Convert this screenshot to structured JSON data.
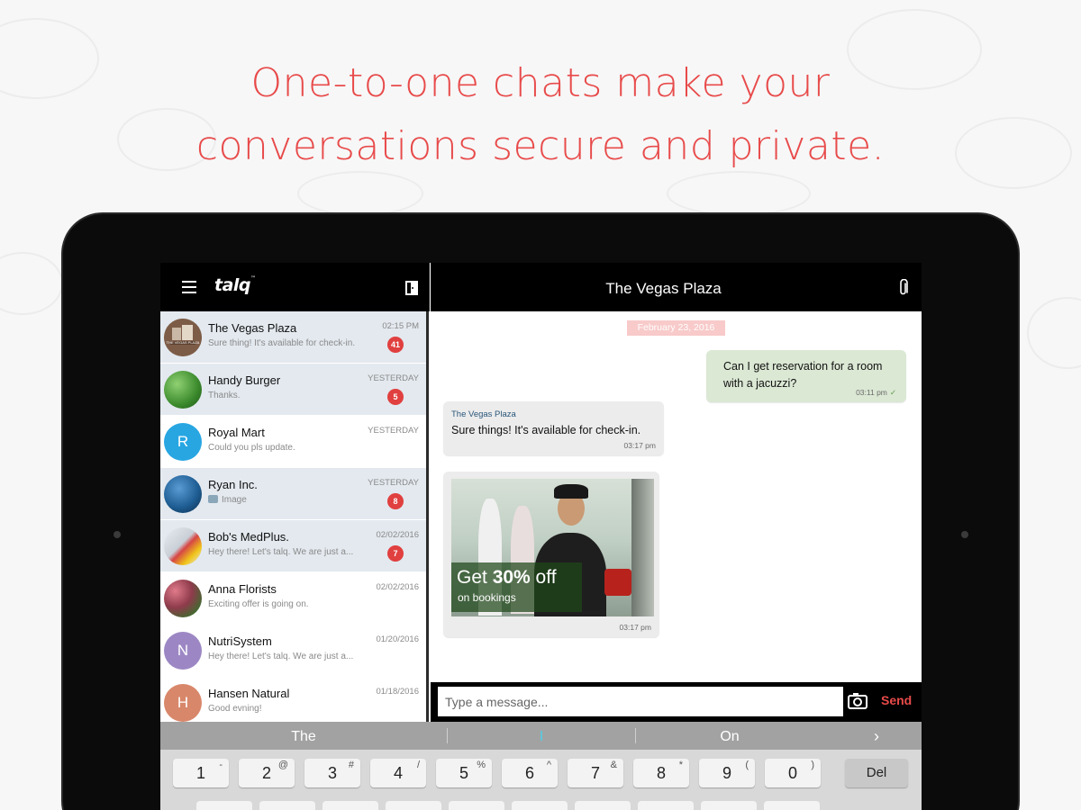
{
  "headline": {
    "line1": "One-to-one chats make your",
    "line2": "conversations secure and private."
  },
  "app": {
    "logo": "talq",
    "logo_mark": "™",
    "menu_icon": "hamburger-menu-icon",
    "exit_icon": "door-exit-icon",
    "attach_icon": "paperclip-icon"
  },
  "conversation_list": [
    {
      "name": "The Vegas Plaza",
      "preview": "Sure thing! It's available for check-in.",
      "time": "02:15 PM",
      "badge": "41",
      "avatar_text": "THE VEGAS PLAZA",
      "avatar_color": "#8a6a55",
      "unread": true
    },
    {
      "name": "Handy Burger",
      "preview": "Thanks.",
      "time": "YESTERDAY",
      "badge": "5",
      "avatar_text": "",
      "avatar_color": "#4c9a3d",
      "unread": true
    },
    {
      "name": "Royal Mart",
      "preview": "Could you pls update.",
      "time": "YESTERDAY",
      "badge": "",
      "avatar_text": "R",
      "avatar_color": "#27a6e2",
      "unread": false
    },
    {
      "name": "Ryan Inc.",
      "preview": "Image",
      "time": "YESTERDAY",
      "badge": "8",
      "avatar_text": "",
      "avatar_color": "#1f5f95",
      "unread": true,
      "preview_icon": "image-icon"
    },
    {
      "name": "Bob's MedPlus.",
      "preview": "Hey there! Let's talq. We are just a...",
      "time": "02/02/2016",
      "badge": "7",
      "avatar_text": "",
      "avatar_color": "#c9cfd6",
      "unread": true
    },
    {
      "name": "Anna Florists",
      "preview": "Exciting offer is going on.",
      "time": "02/02/2016",
      "badge": "",
      "avatar_text": "",
      "avatar_color": "#8e3b4b",
      "unread": false
    },
    {
      "name": "NutriSystem",
      "preview": "Hey there! Let's talq. We are just a...",
      "time": "01/20/2016",
      "badge": "",
      "avatar_text": "N",
      "avatar_color": "#9c87c4",
      "unread": false
    },
    {
      "name": "Hansen Natural",
      "preview": "Good evning!",
      "time": "01/18/2016",
      "badge": "",
      "avatar_text": "H",
      "avatar_color": "#d8876a",
      "unread": false
    }
  ],
  "chat": {
    "title": "The Vegas Plaza",
    "date": "February 23, 2016",
    "outgoing": {
      "text": "Can I get reservation for a room with a jacuzzi?",
      "time": "03:11 pm",
      "tick": "✓"
    },
    "incoming": {
      "sender": "The Vegas Plaza",
      "text": "Sure things! It's available for check-in.",
      "time": "03:17 pm"
    },
    "image_message": {
      "promo_prefix": "Get ",
      "promo_bold": "30%",
      "promo_suffix": " off",
      "promo_sub": "on bookings",
      "time": "03:17 pm"
    },
    "input_placeholder": "Type a message...",
    "camera_icon": "camera-icon",
    "send_label": "Send"
  },
  "keyboard": {
    "suggestions": [
      "The",
      "I",
      "On"
    ],
    "more_icon": "chevron-right-icon",
    "more_label": "›",
    "keys": [
      {
        "main": "1",
        "alt": "-"
      },
      {
        "main": "2",
        "alt": "@"
      },
      {
        "main": "3",
        "alt": "#"
      },
      {
        "main": "4",
        "alt": "/"
      },
      {
        "main": "5",
        "alt": "%"
      },
      {
        "main": "6",
        "alt": "^"
      },
      {
        "main": "7",
        "alt": "&"
      },
      {
        "main": "8",
        "alt": "*"
      },
      {
        "main": "9",
        "alt": "("
      },
      {
        "main": "0",
        "alt": ")"
      }
    ],
    "delete_label": "Del"
  },
  "colors": {
    "accent": "#e84a4a",
    "unread_row": "#e3e9ef",
    "outgoing_bubble": "#dbe8d4",
    "incoming_bubble": "#ececec",
    "badge": "#e0403f"
  }
}
